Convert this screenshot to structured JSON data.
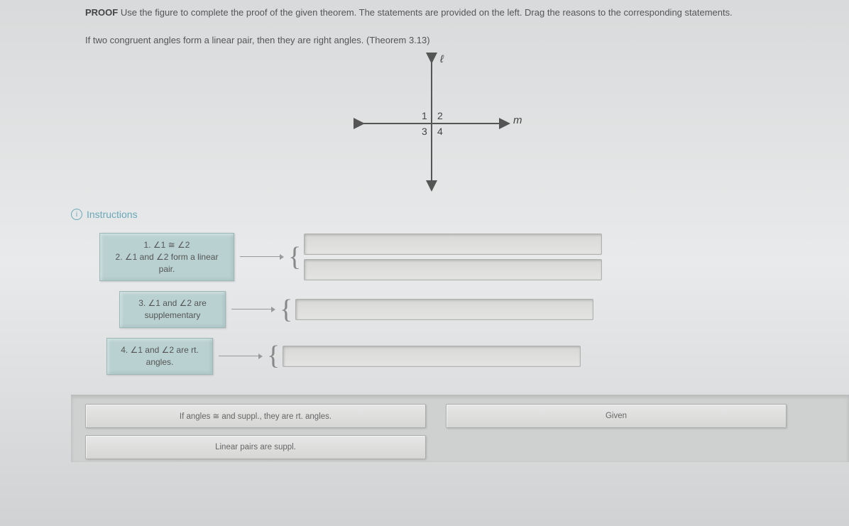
{
  "header": {
    "bold": "PROOF",
    "text": " Use the figure to complete the proof of the given theorem. The statements are provided on the left. Drag the reasons to the corresponding statements."
  },
  "theorem": "If two congruent angles form a linear pair, then they are right angles. (Theorem 3.13)",
  "figure": {
    "label_l": "ℓ",
    "label_m": "m",
    "q1": "1",
    "q2": "2",
    "q3": "3",
    "q4": "4"
  },
  "instructions_label": "Instructions",
  "statements": {
    "s1_line1": "1. ∠1 ≅ ∠2",
    "s1_line2": "2. ∠1 and ∠2 form a linear pair.",
    "s2": "3. ∠1 and ∠2 are supplementary",
    "s3": "4. ∠1 and ∠2 are rt. angles."
  },
  "reasons_pool": {
    "r1": "If angles ≅ and suppl., they are rt. angles.",
    "r2": "Given",
    "r3": "Linear pairs are suppl."
  }
}
